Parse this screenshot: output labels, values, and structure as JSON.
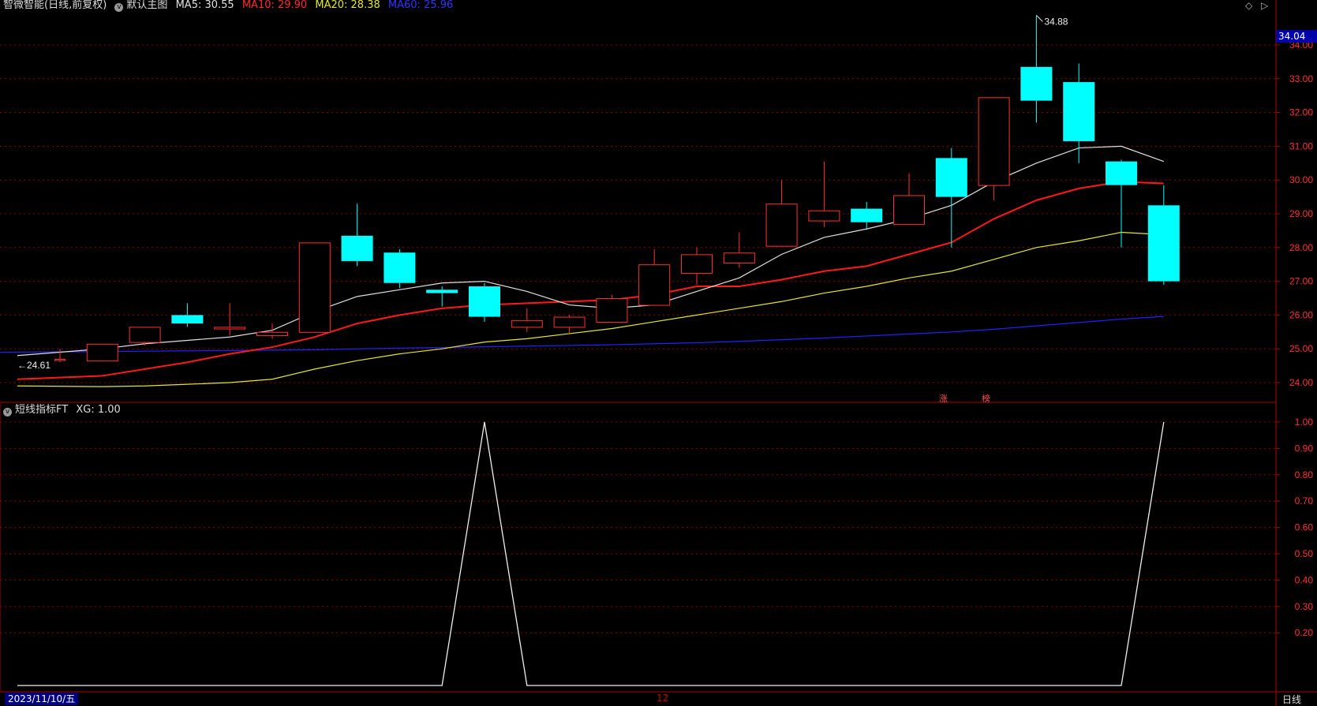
{
  "header": {
    "title": "智微智能(日线,前复权)",
    "template": "默认主图",
    "ma5_label": "MA5: 30.55",
    "ma10_label": "MA10: 29.90",
    "ma20_label": "MA20: 28.38",
    "ma60_label": "MA60: 25.96"
  },
  "indicator_header": {
    "name": "短线指标FT",
    "xg_label": "XG: 1.00"
  },
  "corner_icons": {
    "left": "◇",
    "right": "▷"
  },
  "current_price": "34.04",
  "footer": {
    "start_date": "2023/11/10/五",
    "mid_marker": "12",
    "period": "日线"
  },
  "event_marks": [
    "涨",
    "榜"
  ],
  "colors": {
    "up": "#ff3030",
    "down": "#00ffff",
    "ma5": "#e0e0e0",
    "ma10": "#ff1a1a",
    "ma20": "#e6e62e",
    "ma60": "#2222ff",
    "grid": "#8b0000",
    "frame": "#b00000"
  },
  "chart_data": [
    {
      "type": "candlestick",
      "price_axis_ticks": [
        "34.00",
        "33.00",
        "32.00",
        "31.00",
        "30.00",
        "29.00",
        "28.00",
        "27.00",
        "26.00",
        "25.00",
        "24.00"
      ],
      "ylim": [
        23.7,
        35.2
      ],
      "high_annotation": "34.88",
      "low_annotation": "24.61",
      "candles": [
        {
          "o": 24.7,
          "h": 25.0,
          "l": 24.61,
          "c": 24.7
        },
        {
          "o": 24.65,
          "h": 25.15,
          "l": 24.65,
          "c": 25.15
        },
        {
          "o": 25.2,
          "h": 25.65,
          "l": 25.1,
          "c": 25.65
        },
        {
          "o": 26.0,
          "h": 26.35,
          "l": 25.65,
          "c": 25.75
        },
        {
          "o": 25.6,
          "h": 26.35,
          "l": 25.4,
          "c": 25.65
        },
        {
          "o": 25.4,
          "h": 25.75,
          "l": 25.3,
          "c": 25.5
        },
        {
          "o": 25.5,
          "h": 28.15,
          "l": 25.5,
          "c": 28.15
        },
        {
          "o": 28.35,
          "h": 29.3,
          "l": 27.45,
          "c": 27.6
        },
        {
          "o": 27.85,
          "h": 27.95,
          "l": 26.8,
          "c": 26.95
        },
        {
          "o": 26.75,
          "h": 26.85,
          "l": 26.25,
          "c": 26.65
        },
        {
          "o": 26.85,
          "h": 26.95,
          "l": 25.8,
          "c": 25.95
        },
        {
          "o": 25.65,
          "h": 26.2,
          "l": 25.5,
          "c": 25.85
        },
        {
          "o": 25.65,
          "h": 26.0,
          "l": 25.45,
          "c": 25.95
        },
        {
          "o": 25.8,
          "h": 26.6,
          "l": 25.8,
          "c": 26.5
        },
        {
          "o": 26.3,
          "h": 27.95,
          "l": 26.3,
          "c": 27.5
        },
        {
          "o": 27.25,
          "h": 28.0,
          "l": 26.9,
          "c": 27.8
        },
        {
          "o": 27.55,
          "h": 28.45,
          "l": 27.4,
          "c": 27.85
        },
        {
          "o": 28.05,
          "h": 30.0,
          "l": 28.05,
          "c": 29.3
        },
        {
          "o": 28.8,
          "h": 30.55,
          "l": 28.6,
          "c": 29.1
        },
        {
          "o": 29.15,
          "h": 29.35,
          "l": 28.55,
          "c": 28.75
        },
        {
          "o": 28.7,
          "h": 30.2,
          "l": 28.7,
          "c": 29.55
        },
        {
          "o": 30.65,
          "h": 30.95,
          "l": 28.0,
          "c": 29.5
        },
        {
          "o": 29.85,
          "h": 32.45,
          "l": 29.4,
          "c": 32.45
        },
        {
          "o": 33.35,
          "h": 34.88,
          "l": 31.7,
          "c": 32.35
        },
        {
          "o": 32.9,
          "h": 33.45,
          "l": 30.5,
          "c": 31.15
        },
        {
          "o": 30.55,
          "h": 30.6,
          "l": 28.0,
          "c": 29.85
        },
        {
          "o": 29.25,
          "h": 29.85,
          "l": 26.9,
          "c": 27.0
        }
      ],
      "ma5": [
        24.8,
        25.0,
        25.15,
        25.25,
        25.35,
        25.55,
        26.1,
        26.55,
        26.75,
        26.95,
        27.0,
        26.7,
        26.3,
        26.2,
        26.3,
        26.7,
        27.1,
        27.8,
        28.3,
        28.55,
        28.85,
        29.25,
        29.95,
        30.5,
        30.95,
        31.0,
        30.55
      ],
      "ma10": [
        24.1,
        24.2,
        24.4,
        24.6,
        24.85,
        25.05,
        25.35,
        25.75,
        26.0,
        26.2,
        26.3,
        26.35,
        26.4,
        26.45,
        26.6,
        26.85,
        26.85,
        27.05,
        27.3,
        27.45,
        27.8,
        28.15,
        28.85,
        29.4,
        29.75,
        29.95,
        29.9
      ],
      "ma20": [
        23.9,
        23.88,
        23.9,
        23.95,
        24.0,
        24.1,
        24.4,
        24.65,
        24.85,
        25.0,
        25.2,
        25.3,
        25.45,
        25.6,
        25.8,
        26.0,
        26.2,
        26.4,
        26.65,
        26.85,
        27.1,
        27.3,
        27.65,
        28.0,
        28.2,
        28.45,
        28.38
      ],
      "ma60": [
        24.9,
        24.92,
        24.93,
        24.94,
        24.95,
        24.96,
        24.97,
        25.0,
        25.02,
        25.04,
        25.06,
        25.08,
        25.1,
        25.12,
        25.15,
        25.18,
        25.22,
        25.27,
        25.32,
        25.38,
        25.44,
        25.5,
        25.58,
        25.68,
        25.78,
        25.88,
        25.96
      ]
    },
    {
      "type": "line",
      "name": "XG",
      "axis_ticks": [
        "1.00",
        "0.90",
        "0.80",
        "0.70",
        "0.60",
        "0.50",
        "0.40",
        "0.30",
        "0.20"
      ],
      "ylim": [
        0,
        1.08
      ],
      "values": [
        0,
        0,
        0,
        0,
        0,
        0,
        0,
        0,
        0,
        0,
        1,
        0,
        0,
        0,
        0,
        0,
        0,
        0,
        0,
        0,
        0,
        0,
        0,
        0,
        0,
        0,
        1
      ]
    }
  ]
}
